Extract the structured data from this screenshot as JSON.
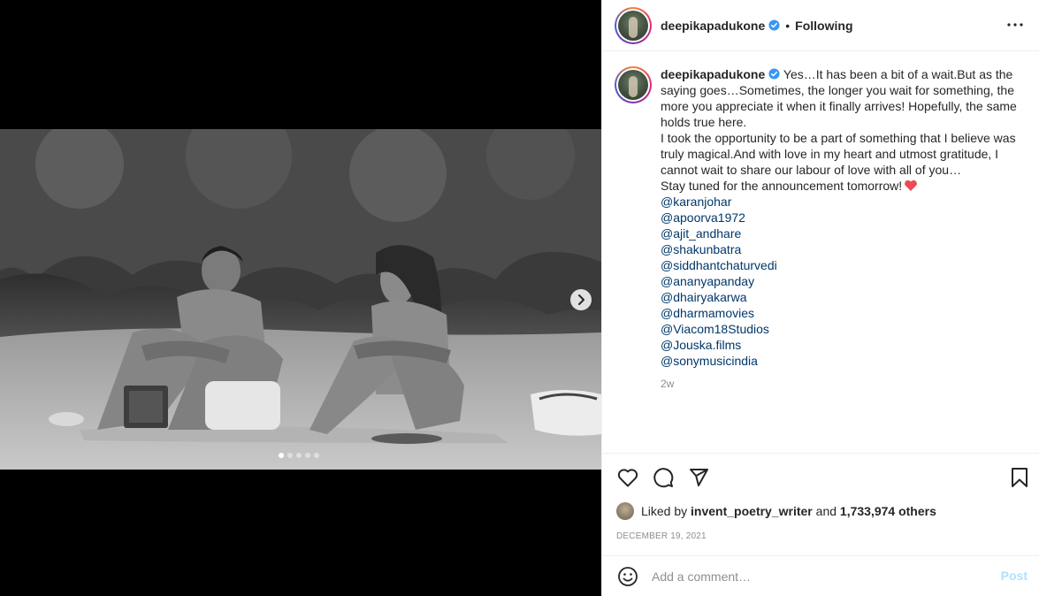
{
  "post": {
    "username": "deepikapadukone",
    "follow_status": "Following",
    "separator": "•",
    "more_label": "•••"
  },
  "caption": {
    "username": "deepikapadukone",
    "para1": "Yes…It has been a bit of a wait.But as the saying goes…Sometimes, the longer you wait for something, the more you appreciate it when it finally arrives! Hopefully, the same holds true here.",
    "para2": "I took the opportunity to be a part of something that I believe was truly magical.And with love in my heart and utmost gratitude, I cannot wait to share our labour of love with all of you…",
    "para3": "Stay tuned for the announcement tomorrow!",
    "mentions": [
      "@karanjohar",
      "@apoorva1972",
      "@ajit_andhare",
      "@shakunbatra",
      "@siddhantchaturvedi",
      "@ananyapanday",
      "@dhairyakarwa",
      "@dharmamovies",
      "@Viacom18Studios",
      "@Jouska.films",
      "@sonymusicindia"
    ],
    "time_ago": "2w"
  },
  "likes": {
    "prefix": "Liked by",
    "user": "invent_poetry_writer",
    "connector": "and",
    "count": "1,733,974 others"
  },
  "date": "DECEMBER 19, 2021",
  "comment": {
    "placeholder": "Add a comment…",
    "post_label": "Post"
  },
  "carousel": {
    "total": 5,
    "active_index": 0
  },
  "colors": {
    "verified": "#3897f0",
    "mention": "#00376b",
    "heart": "#ed4956",
    "muted": "#8e8e8e",
    "post_disabled": "#b2dffc"
  }
}
